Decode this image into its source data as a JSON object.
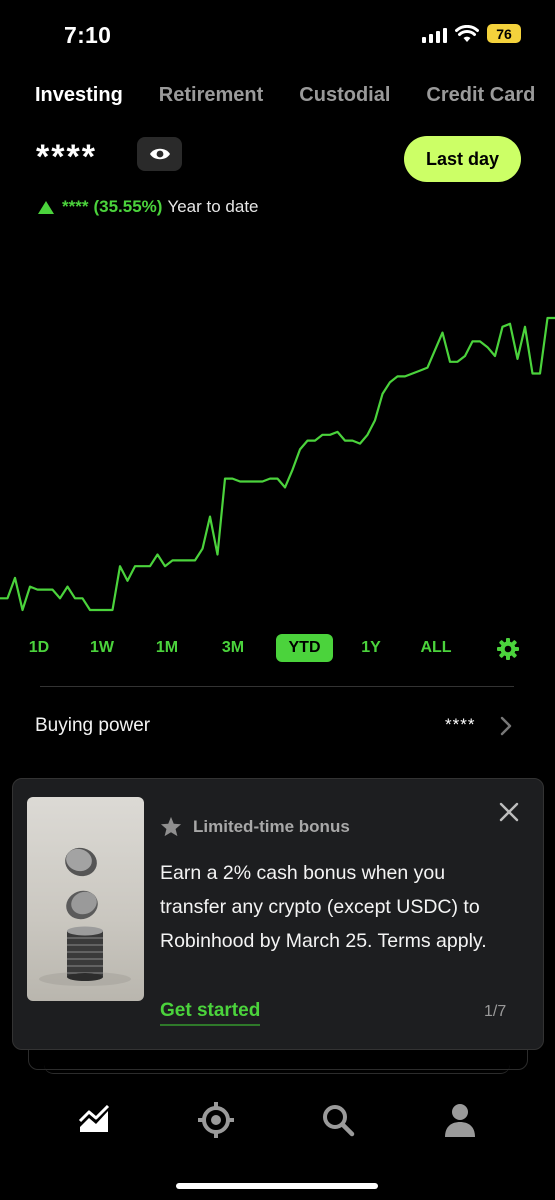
{
  "status_bar": {
    "time": "7:10",
    "battery": "76"
  },
  "accounts": {
    "tabs": [
      "Investing",
      "Retirement",
      "Custodial",
      "Credit Card"
    ],
    "active_index": 0
  },
  "portfolio": {
    "balance": "****",
    "change_amount": "****",
    "change_percent": "(35.55%)",
    "change_period": "Year to date",
    "last_day_label": "Last day"
  },
  "chart_data": {
    "type": "line",
    "title": "",
    "xlabel": "",
    "ylabel": "",
    "color": "#4bd33c",
    "ylim": [
      0,
      100
    ],
    "values": [
      4,
      4,
      11,
      0,
      8,
      7,
      7,
      7,
      4,
      8,
      4,
      4,
      0,
      0,
      0,
      0,
      15,
      10,
      15,
      15,
      15,
      19,
      15,
      17,
      17,
      17,
      17,
      21,
      32,
      19,
      45,
      45,
      44,
      44,
      44,
      44,
      45,
      45,
      42,
      48,
      55,
      58,
      58,
      60,
      60,
      61,
      58,
      58,
      57,
      60,
      65,
      74,
      78,
      80,
      80,
      81,
      82,
      83,
      89,
      95,
      85,
      85,
      87,
      92,
      92,
      90,
      87,
      97,
      98,
      86,
      97,
      81,
      81,
      100,
      100
    ]
  },
  "ranges": {
    "items": [
      "1D",
      "1W",
      "1M",
      "3M",
      "YTD",
      "1Y",
      "ALL"
    ],
    "active_index": 4
  },
  "buying_power": {
    "label": "Buying power",
    "value": "****"
  },
  "promo": {
    "tag": "Limited-time bonus",
    "lines": [
      "Earn a 2% cash bonus when you",
      "transfer any crypto (except USDC) to",
      "Robinhood by March 25. Terms apply."
    ],
    "cta": "Get started",
    "page": "1/7"
  },
  "bottom_nav": {
    "icons": [
      "investing-icon",
      "crypto-icon",
      "search-icon",
      "account-icon"
    ],
    "active_index": 0
  }
}
